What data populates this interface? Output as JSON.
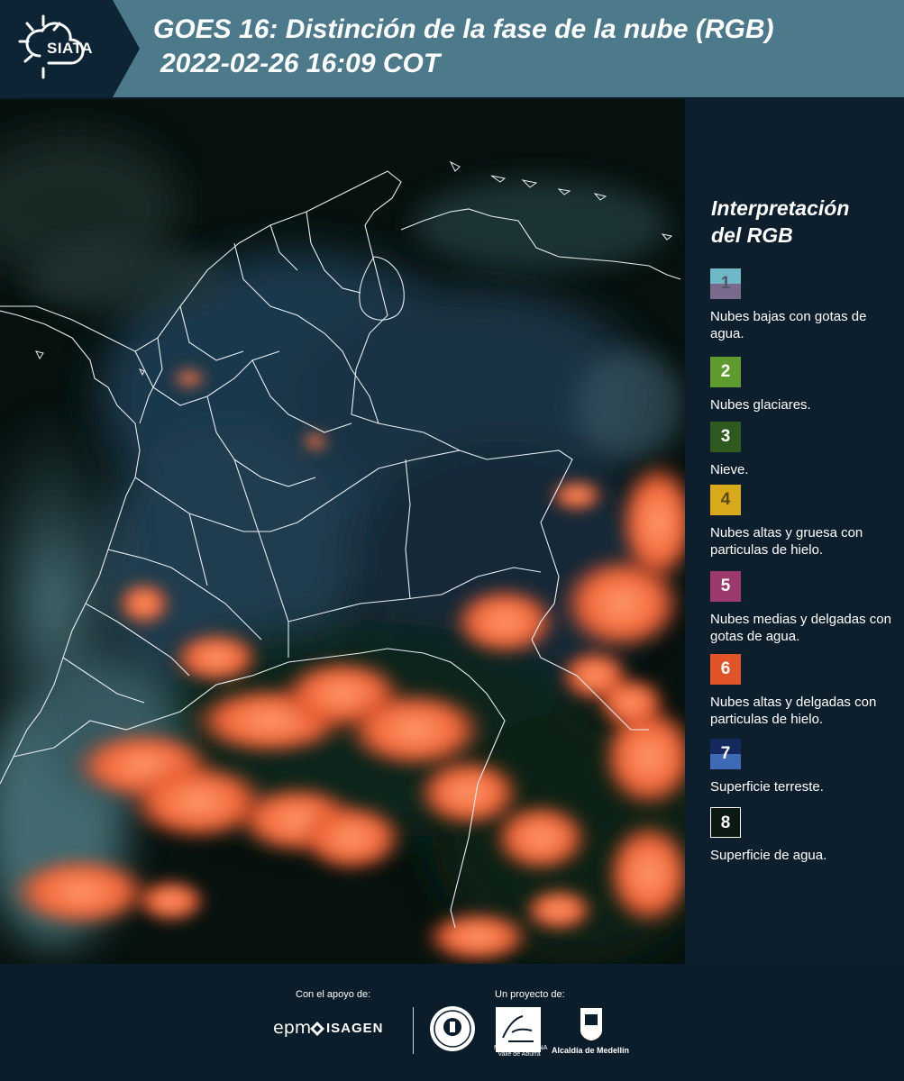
{
  "header": {
    "logo_text": "SIATA",
    "title_line1": "GOES 16: Distinción de la fase de la nube (RGB)",
    "title_line2": "2022-02-26 16:09 COT"
  },
  "legend": {
    "title_line1": "Interpretación",
    "title_line2": "del RGB",
    "items": [
      {
        "number": "1",
        "label": "Nubes bajas con gotas de agua.",
        "color_top": "#6fb8c8",
        "color_bottom": "#7a6a8c",
        "text_color": "#555566"
      },
      {
        "number": "2",
        "label": "Nubes glaciares.",
        "color_top": "#5e9a2e",
        "color_bottom": "#5e9a2e",
        "text_color": "#ffffff"
      },
      {
        "number": "3",
        "label": "Nieve.",
        "color_top": "#2f5a1f",
        "color_bottom": "#2f5a1f",
        "text_color": "#ffffff"
      },
      {
        "number": "4",
        "label": "Nubes altas y gruesa con particulas de hielo.",
        "color_top": "#d9a91c",
        "color_bottom": "#d9a91c",
        "text_color": "#5a4a10"
      },
      {
        "number": "5",
        "label": "Nubes medias y delgadas con gotas de agua.",
        "color_top": "#9c3a6e",
        "color_bottom": "#9c3a6e",
        "text_color": "#ffffff"
      },
      {
        "number": "6",
        "label": "Nubes altas y delgadas con particulas de hielo.",
        "color_top": "#e2532a",
        "color_bottom": "#e2532a",
        "text_color": "#ffffff"
      },
      {
        "number": "7",
        "label": "Superficie terreste.",
        "color_top": "#142a5e",
        "color_bottom": "#3f6ab5",
        "text_color": "#ffffff"
      },
      {
        "number": "8",
        "label": "Superficie de agua.",
        "color_top": "#0a1a12",
        "color_bottom": "#0a1a12",
        "text_color": "#ffffff"
      }
    ]
  },
  "footer": {
    "support_label": "Con el apoyo de:",
    "project_label": "Un proyecto de:",
    "sponsor_epm": "epm",
    "sponsor_isagen": "ISAGEN",
    "area_text": "METROPOLITANA Valle de Aburrá",
    "alcaldia_text": "Alcaldía de Medellín"
  }
}
